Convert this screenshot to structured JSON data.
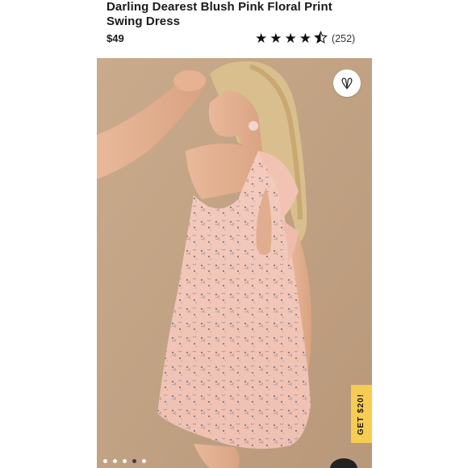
{
  "product": {
    "title_line1": "Darling Dearest Blush Pink Floral Print",
    "title_line2": "Swing Dress",
    "price": "$49",
    "rating": 4.5,
    "stars": [
      "★",
      "★",
      "★",
      "★",
      "⯪"
    ],
    "review_count": "(252)"
  },
  "gallery": {
    "image_count": 5,
    "active_index": 3,
    "favorite_icon": "heart-v-icon"
  },
  "promo": {
    "label": "GET $20!"
  },
  "colors": {
    "background": "#ffffff",
    "photo_backdrop": "#c7a888",
    "dress": "#f3c7ba",
    "promo": "#f7cc52"
  }
}
